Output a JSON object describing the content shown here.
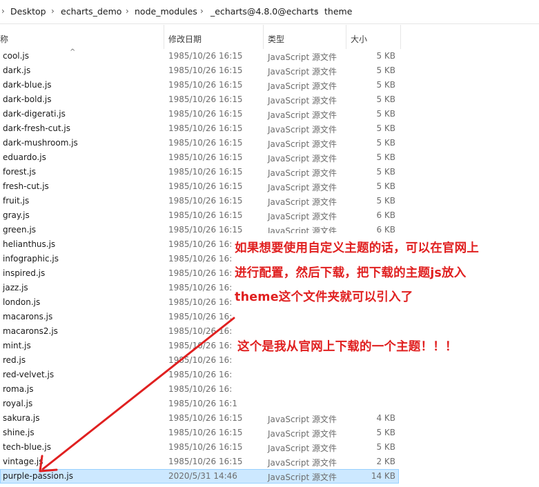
{
  "breadcrumb": {
    "items": [
      "Desktop",
      "echarts_demo",
      "node_modules",
      "_echarts@4.8.0@echarts",
      "theme"
    ],
    "separator": "›"
  },
  "columns": {
    "name": "称",
    "date": "修改日期",
    "type": "类型",
    "size": "大小"
  },
  "files": [
    {
      "name": "cool.js",
      "date": "1985/10/26 16:15",
      "type": "JavaScript 源文件",
      "size": "5 KB"
    },
    {
      "name": "dark.js",
      "date": "1985/10/26 16:15",
      "type": "JavaScript 源文件",
      "size": "5 KB"
    },
    {
      "name": "dark-blue.js",
      "date": "1985/10/26 16:15",
      "type": "JavaScript 源文件",
      "size": "5 KB"
    },
    {
      "name": "dark-bold.js",
      "date": "1985/10/26 16:15",
      "type": "JavaScript 源文件",
      "size": "5 KB"
    },
    {
      "name": "dark-digerati.js",
      "date": "1985/10/26 16:15",
      "type": "JavaScript 源文件",
      "size": "5 KB"
    },
    {
      "name": "dark-fresh-cut.js",
      "date": "1985/10/26 16:15",
      "type": "JavaScript 源文件",
      "size": "5 KB"
    },
    {
      "name": "dark-mushroom.js",
      "date": "1985/10/26 16:15",
      "type": "JavaScript 源文件",
      "size": "5 KB"
    },
    {
      "name": "eduardo.js",
      "date": "1985/10/26 16:15",
      "type": "JavaScript 源文件",
      "size": "5 KB"
    },
    {
      "name": "forest.js",
      "date": "1985/10/26 16:15",
      "type": "JavaScript 源文件",
      "size": "5 KB"
    },
    {
      "name": "fresh-cut.js",
      "date": "1985/10/26 16:15",
      "type": "JavaScript 源文件",
      "size": "5 KB"
    },
    {
      "name": "fruit.js",
      "date": "1985/10/26 16:15",
      "type": "JavaScript 源文件",
      "size": "5 KB"
    },
    {
      "name": "gray.js",
      "date": "1985/10/26 16:15",
      "type": "JavaScript 源文件",
      "size": "6 KB"
    },
    {
      "name": "green.js",
      "date": "1985/10/26 16:15",
      "type": "JavaScript 源文件",
      "size": "6 KB"
    },
    {
      "name": "helianthus.js",
      "date": "1985/10/26 16:1",
      "type": "",
      "size": ""
    },
    {
      "name": "infographic.js",
      "date": "1985/10/26 16:1",
      "type": "",
      "size": ""
    },
    {
      "name": "inspired.js",
      "date": "1985/10/26 16:1",
      "type": "",
      "size": ""
    },
    {
      "name": "jazz.js",
      "date": "1985/10/26 16:1",
      "type": "",
      "size": ""
    },
    {
      "name": "london.js",
      "date": "1985/10/26 16:1",
      "type": "",
      "size": ""
    },
    {
      "name": "macarons.js",
      "date": "1985/10/26 16:1",
      "type": "",
      "size": ""
    },
    {
      "name": "macarons2.js",
      "date": "1985/10/26 16:1",
      "type": "",
      "size": ""
    },
    {
      "name": "mint.js",
      "date": "1985/10/26 16:1",
      "type": "",
      "size": ""
    },
    {
      "name": "red.js",
      "date": "1985/10/26 16:1",
      "type": "",
      "size": ""
    },
    {
      "name": "red-velvet.js",
      "date": "1985/10/26 16:1",
      "type": "",
      "size": ""
    },
    {
      "name": "roma.js",
      "date": "1985/10/26 16:1",
      "type": "",
      "size": ""
    },
    {
      "name": "royal.js",
      "date": "1985/10/26 16:1",
      "type": "",
      "size": ""
    },
    {
      "name": "sakura.js",
      "date": "1985/10/26 16:15",
      "type": "JavaScript 源文件",
      "size": "4 KB"
    },
    {
      "name": "shine.js",
      "date": "1985/10/26 16:15",
      "type": "JavaScript 源文件",
      "size": "5 KB"
    },
    {
      "name": "tech-blue.js",
      "date": "1985/10/26 16:15",
      "type": "JavaScript 源文件",
      "size": "5 KB"
    },
    {
      "name": "vintage.js",
      "date": "1985/10/26 16:15",
      "type": "JavaScript 源文件",
      "size": "2 KB"
    },
    {
      "name": "purple-passion.js",
      "date": "2020/5/31 14:46",
      "type": "JavaScript 源文件",
      "size": "14 KB",
      "selected": true
    }
  ],
  "annotation": {
    "line1": "如果想要使用自定义主题的话，可以在官网上",
    "line2": "进行配置，然后下载，把下载的主题js放入",
    "line3": "theme这个文件夹就可以引入了",
    "line4": "这个是我从官网上下载的一个主题！！！",
    "color": "#e02020"
  },
  "colors": {
    "selection_bg": "#cce8ff",
    "selection_border": "#99d1ff",
    "arrow": "#e02020"
  }
}
